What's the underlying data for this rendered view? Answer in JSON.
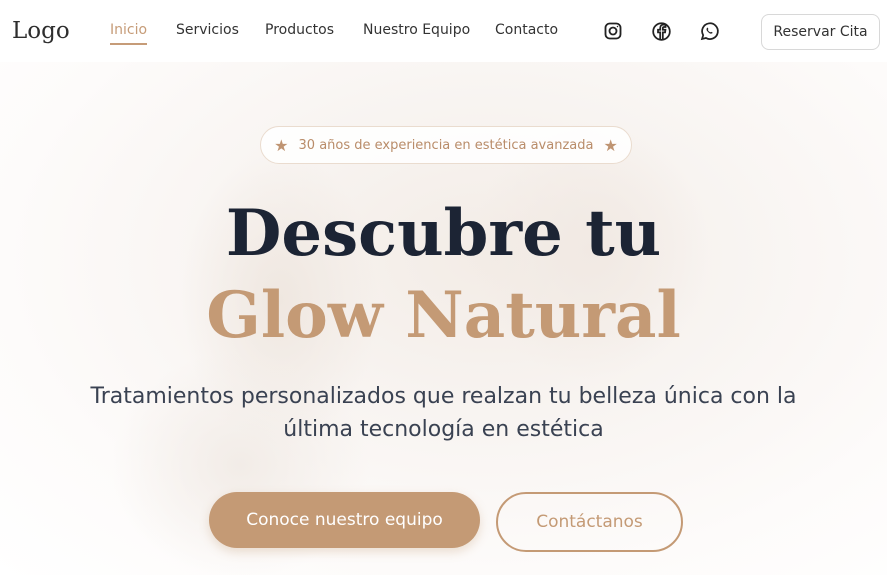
{
  "nav": {
    "logo": "Logo",
    "links": [
      {
        "label": "Inicio",
        "active": true
      },
      {
        "label": "Servicios",
        "active": false
      },
      {
        "label": "Productos",
        "active": false
      },
      {
        "label": "Nuestro Equipo",
        "active": false
      },
      {
        "label": "Contacto",
        "active": false
      }
    ],
    "social_icons": [
      "instagram-icon",
      "facebook-icon",
      "whatsapp-icon"
    ],
    "cta_label": "Reservar Cita"
  },
  "hero": {
    "badge_text": "30 años de experiencia en estética avanzada",
    "badge_icon": "star-icon",
    "title_line1": "Descubre tu",
    "title_line2": "Glow Natural",
    "subtitle": "Tratamientos personalizados que realzan tu belleza única con la última tecnología en estética",
    "primary_button": "Conoce nuestro equipo",
    "secondary_button": "Contáctanos"
  },
  "colors": {
    "accent": "#c49a75",
    "title_dark": "#1c2434",
    "text": "#3a4252"
  }
}
